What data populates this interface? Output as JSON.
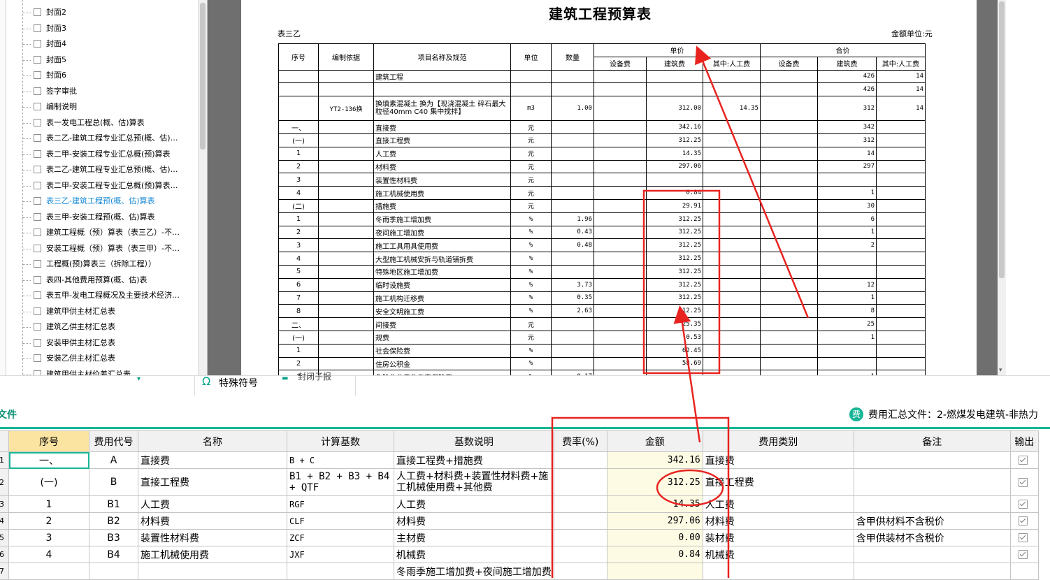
{
  "tree": {
    "items": [
      {
        "label": "封面2",
        "active": false
      },
      {
        "label": "封面3",
        "active": false
      },
      {
        "label": "封面4",
        "active": false
      },
      {
        "label": "封面5",
        "active": false
      },
      {
        "label": "封面6",
        "active": false
      },
      {
        "label": "签字审批",
        "active": false
      },
      {
        "label": "编制说明",
        "active": false
      },
      {
        "label": "表一发电工程总(概、估)算表",
        "active": false
      },
      {
        "label": "表二乙-建筑工程专业汇总预(概、估)…",
        "active": false
      },
      {
        "label": "表二甲-安装工程专业汇总概(预)算表",
        "active": false
      },
      {
        "label": "表二乙-建筑工程专业汇总预(概、估)…",
        "active": false
      },
      {
        "label": "表二甲-安装工程专业汇总概(预)算表…",
        "active": false
      },
      {
        "label": "表三乙-建筑工程预(概、估)算表",
        "active": true
      },
      {
        "label": "表三甲-安装工程预(概、估)算表",
        "active": false
      },
      {
        "label": "建筑工程概（预）算表（表三乙）-不…",
        "active": false
      },
      {
        "label": "安装工程概（预）算表（表三甲）-不…",
        "active": false
      },
      {
        "label": "工程概(预)算表三（拆除工程））",
        "active": false
      },
      {
        "label": "表四-其他费用预算(概、估)表",
        "active": false
      },
      {
        "label": "表五甲-发电工程概况及主要技术经济…",
        "active": false
      },
      {
        "label": "建筑甲供主材汇总表",
        "active": false
      },
      {
        "label": "建筑乙供主材汇总表",
        "active": false
      },
      {
        "label": "安装甲供主材汇总表",
        "active": false
      },
      {
        "label": "安装乙供主材汇总表",
        "active": false
      },
      {
        "label": "建筑甲供主材价差汇总表",
        "active": false
      }
    ]
  },
  "doc": {
    "title": "建筑工程预算表",
    "table_code": "表三乙",
    "unit_note": "金额单位:元",
    "headers": {
      "seq": "序号",
      "basis": "编制依据",
      "name": "项目名称及规范",
      "unit": "单位",
      "qty": "数量",
      "unit_price": "单价",
      "total": "合价",
      "equip": "设备费",
      "build": "建筑费",
      "labor": "其中:人工费"
    },
    "rows": [
      {
        "seq": "",
        "basis": "",
        "name": "建筑工程",
        "unit": "",
        "qty": "",
        "ue": "",
        "ub": "",
        "ul": "",
        "te": "",
        "tb": "426",
        "tl": "14"
      },
      {
        "seq": "",
        "basis": "",
        "name": "",
        "unit": "",
        "qty": "",
        "ue": "",
        "ub": "",
        "ul": "",
        "te": "",
        "tb": "426",
        "tl": "14"
      },
      {
        "seq": "",
        "basis": "YT2-136换",
        "name": "换填素混凝土 换为【现浇混凝土 碎石最大粒径40mm C40 集中搅拌】",
        "unit": "m3",
        "qty": "1.00",
        "ue": "",
        "ub": "312.00",
        "ul": "14.35",
        "te": "",
        "tb": "312",
        "tl": "14",
        "tall": true
      },
      {
        "seq": "一、",
        "basis": "",
        "name": "直接费",
        "unit": "元",
        "qty": "",
        "ue": "",
        "ub": "342.16",
        "ul": "",
        "te": "",
        "tb": "342",
        "tl": ""
      },
      {
        "seq": "(一)",
        "basis": "",
        "name": "直接工程费",
        "unit": "元",
        "qty": "",
        "ue": "",
        "ub": "312.25",
        "ul": "",
        "te": "",
        "tb": "312",
        "tl": ""
      },
      {
        "seq": "1",
        "basis": "",
        "name": "人工费",
        "unit": "元",
        "qty": "",
        "ue": "",
        "ub": "14.35",
        "ul": "",
        "te": "",
        "tb": "14",
        "tl": ""
      },
      {
        "seq": "2",
        "basis": "",
        "name": "材料费",
        "unit": "元",
        "qty": "",
        "ue": "",
        "ub": "297.06",
        "ul": "",
        "te": "",
        "tb": "297",
        "tl": ""
      },
      {
        "seq": "3",
        "basis": "",
        "name": "装置性材料费",
        "unit": "元",
        "qty": "",
        "ue": "",
        "ub": "",
        "ul": "",
        "te": "",
        "tb": "",
        "tl": ""
      },
      {
        "seq": "4",
        "basis": "",
        "name": "施工机械使用费",
        "unit": "元",
        "qty": "",
        "ue": "",
        "ub": "0.84",
        "ul": "",
        "te": "",
        "tb": "1",
        "tl": ""
      },
      {
        "seq": "(二)",
        "basis": "",
        "name": "措施费",
        "unit": "元",
        "qty": "",
        "ue": "",
        "ub": "29.91",
        "ul": "",
        "te": "",
        "tb": "30",
        "tl": ""
      },
      {
        "seq": "1",
        "basis": "",
        "name": "冬雨季施工增加费",
        "unit": "%",
        "qty": "1.96",
        "ue": "",
        "ub": "312.25",
        "ul": "",
        "te": "",
        "tb": "6",
        "tl": ""
      },
      {
        "seq": "2",
        "basis": "",
        "name": "夜间施工增加费",
        "unit": "%",
        "qty": "0.43",
        "ue": "",
        "ub": "312.25",
        "ul": "",
        "te": "",
        "tb": "1",
        "tl": ""
      },
      {
        "seq": "3",
        "basis": "",
        "name": "施工工具用具使用费",
        "unit": "%",
        "qty": "0.48",
        "ue": "",
        "ub": "312.25",
        "ul": "",
        "te": "",
        "tb": "2",
        "tl": ""
      },
      {
        "seq": "4",
        "basis": "",
        "name": "大型施工机械安拆与轨道铺拆费",
        "unit": "%",
        "qty": "",
        "ue": "",
        "ub": "312.25",
        "ul": "",
        "te": "",
        "tb": "",
        "tl": ""
      },
      {
        "seq": "5",
        "basis": "",
        "name": "特殊地区施工增加费",
        "unit": "%",
        "qty": "",
        "ue": "",
        "ub": "312.25",
        "ul": "",
        "te": "",
        "tb": "",
        "tl": ""
      },
      {
        "seq": "6",
        "basis": "",
        "name": "临时设施费",
        "unit": "%",
        "qty": "3.73",
        "ue": "",
        "ub": "312.25",
        "ul": "",
        "te": "",
        "tb": "12",
        "tl": ""
      },
      {
        "seq": "7",
        "basis": "",
        "name": "施工机构迁移费",
        "unit": "%",
        "qty": "0.35",
        "ue": "",
        "ub": "312.25",
        "ul": "",
        "te": "",
        "tb": "1",
        "tl": ""
      },
      {
        "seq": "8",
        "basis": "",
        "name": "安全文明施工费",
        "unit": "%",
        "qty": "2.63",
        "ue": "",
        "ub": "312.25",
        "ul": "",
        "te": "",
        "tb": "8",
        "tl": ""
      },
      {
        "seq": "二、",
        "basis": "",
        "name": "间接费",
        "unit": "元",
        "qty": "",
        "ue": "",
        "ub": "25.35",
        "ul": "",
        "te": "",
        "tb": "25",
        "tl": ""
      },
      {
        "seq": "(一)",
        "basis": "",
        "name": "规费",
        "unit": "元",
        "qty": "",
        "ue": "",
        "ub": "0.53",
        "ul": "",
        "te": "",
        "tb": "1",
        "tl": ""
      },
      {
        "seq": "1",
        "basis": "",
        "name": "社会保险费",
        "unit": "%",
        "qty": "",
        "ue": "",
        "ub": "62.45",
        "ul": "",
        "te": "",
        "tb": "",
        "tl": ""
      },
      {
        "seq": "2",
        "basis": "",
        "name": "住房公积金",
        "unit": "%",
        "qty": "",
        "ue": "",
        "ub": "58.69",
        "ul": "",
        "te": "",
        "tb": "",
        "tl": ""
      },
      {
        "seq": "3",
        "basis": "",
        "name": "危险作业意外伤害保险费",
        "unit": "%",
        "qty": "0.17",
        "ue": "",
        "ub": "",
        "ul": "",
        "te": "",
        "tb": "1",
        "tl": ""
      }
    ]
  },
  "toolbar": {
    "special_symbol": "特殊符号",
    "cut_text": "封闭子报"
  },
  "filebar": {
    "tab_label": "文件",
    "summary_icon": "费",
    "summary_text": "费用汇总文件：2-燃煤发电建筑-非热力"
  },
  "grid": {
    "headers": [
      "序号",
      "费用代号",
      "名称",
      "计算基数",
      "基数说明",
      "费率(%)",
      "金额",
      "费用类别",
      "备注",
      "输出"
    ],
    "rows": [
      {
        "n": "1",
        "seq": "一、",
        "code": "A",
        "name": "直接费",
        "base": "B + C",
        "desc": "直接工程费+措施费",
        "rate": "",
        "amount": "342.16",
        "cat": "直接费",
        "note": "",
        "selected": true
      },
      {
        "n": "2",
        "seq": "(一)",
        "code": "B",
        "name": "直接工程费",
        "base": "B1 + B2 + B3 + B4 + QTF",
        "desc": "人工费+材料费+装置性材料费+施工机械使用费+其他费",
        "rate": "",
        "amount": "312.25",
        "cat": "直接工程费",
        "note": "",
        "tall": true
      },
      {
        "n": "3",
        "seq": "1",
        "code": "B1",
        "name": "人工费",
        "base": "RGF",
        "desc": "人工费",
        "rate": "",
        "amount": "14.35",
        "cat": "人工费",
        "note": ""
      },
      {
        "n": "4",
        "seq": "2",
        "code": "B2",
        "name": "材料费",
        "base": "CLF",
        "desc": "材料费",
        "rate": "",
        "amount": "297.06",
        "cat": "材料费",
        "note": "含甲供材料不含税价"
      },
      {
        "n": "5",
        "seq": "3",
        "code": "B3",
        "name": "装置性材料费",
        "base": "ZCF",
        "desc": "主材费",
        "rate": "",
        "amount": "0.00",
        "cat": "装材费",
        "note": "含甲供装材不含税价"
      },
      {
        "n": "6",
        "seq": "4",
        "code": "B4",
        "name": "施工机械使用费",
        "base": "JXF",
        "desc": "机械费",
        "rate": "",
        "amount": "0.84",
        "cat": "机械费",
        "note": ""
      },
      {
        "n": "7",
        "seq": "",
        "code": "",
        "name": "",
        "base": "",
        "desc": "冬雨季施工增加费+夜间施工增加费",
        "rate": "",
        "amount": "",
        "cat": "",
        "note": ""
      }
    ]
  },
  "colors": {
    "accent": "#18b596",
    "annotation": "#e8231f",
    "active_tree": "#1a8cd8"
  }
}
